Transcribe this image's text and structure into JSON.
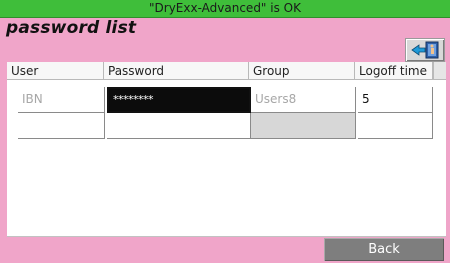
{
  "status": {
    "text": "\"DryExx-Advanced\" is OK",
    "color": "#3fbe3a"
  },
  "screen": {
    "title": "password list",
    "background": "#f0a5c9"
  },
  "exit_button": {
    "icon": "exit-door-icon"
  },
  "table": {
    "columns": [
      "User",
      "Password",
      "Group",
      "Logoff time"
    ],
    "rows": [
      {
        "user": "IBN",
        "password": "********",
        "group": "Users8",
        "logoff_time": "5"
      },
      {
        "user": "",
        "password": "",
        "group": "",
        "logoff_time": ""
      }
    ]
  },
  "back_button": {
    "label": "Back"
  }
}
